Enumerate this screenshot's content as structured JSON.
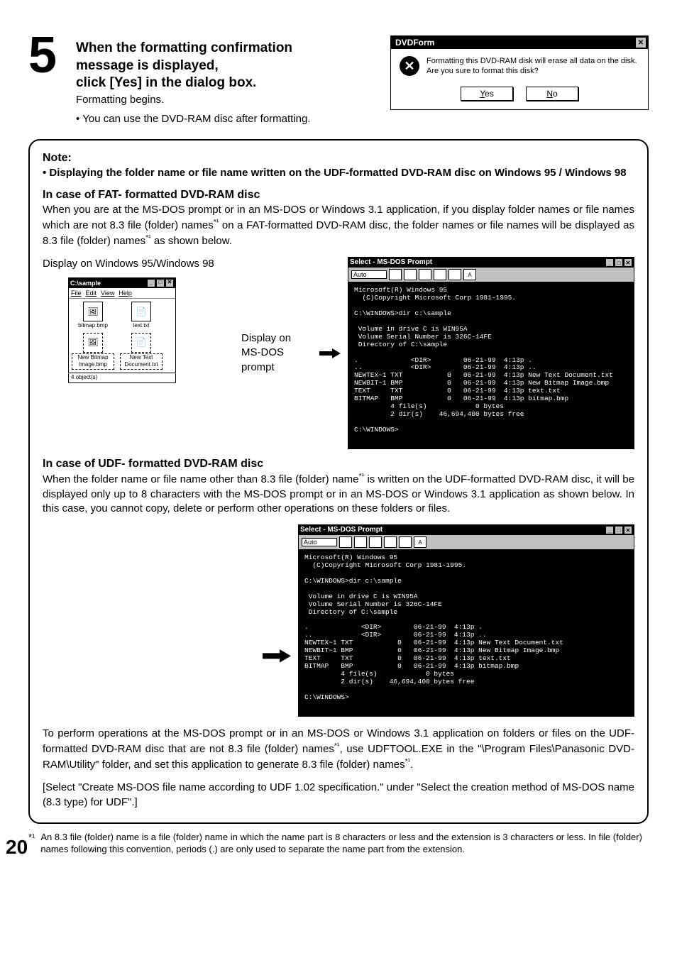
{
  "step": {
    "number": "5",
    "title_l1": "When the formatting confirmation",
    "title_l2": "message is displayed,",
    "title_l3": "click [Yes] in the dialog box.",
    "subtitle": "Formatting begins.",
    "bullet": "You can use the DVD-RAM disc after formatting."
  },
  "dialog": {
    "title": "DVDForm",
    "close": "✕",
    "msg_l1": "Formatting this DVD-RAM disk will erase all data on the disk.",
    "msg_l2": "Are you sure to format this disk?",
    "yes_u": "Y",
    "yes_rest": "es",
    "no_u": "N",
    "no_rest": "o"
  },
  "note": {
    "heading": "Note:",
    "lead": "Displaying the folder name or file name written on the UDF-formatted DVD-RAM disc on Windows 95 / Windows 98",
    "fat_title": "In case of  FAT- formatted DVD-RAM disc",
    "fat_body_a": "When you are at the MS-DOS prompt or in an MS-DOS or Windows 3.1 application, if you display folder names or file names which are not 8.3 file (folder) names",
    "fat_body_b": " on a FAT-formatted DVD-RAM disc, the folder names or file names will be displayed as 8.3 file (folder) names",
    "fat_body_c": " as shown below.",
    "win_label": "Display on Windows 95/Windows 98",
    "dos_label": "Display on MS-DOS prompt",
    "udf_title": "In case of UDF- formatted DVD-RAM disc",
    "udf_body_a": "When the folder name or file name other than 8.3 file (folder) name",
    "udf_body_b": " is written on the UDF-formatted DVD-RAM disc, it will be displayed only up to 8 characters with the MS-DOS prompt or in an MS-DOS or Windows 3.1 application as shown below.  In this case, you cannot copy, delete or perform other operations on these folders or files.",
    "tool_a": "To perform operations at the MS-DOS prompt or in an MS-DOS or Windows 3.1 application on folders or files on the UDF-formatted DVD-RAM disc that are not 8.3 file (folder) names",
    "tool_b": ", use UDFTOOL.EXE in the \"\\Program Files\\Panasonic DVD-RAM\\Utility\" folder, and set this application to generate 8.3 file (folder) names",
    "tool_c": ".",
    "tool_ref": "[Select \"Create MS-DOS file name according to UDF 1.02 specification.\" under  \"Select the creation method  of  MS-DOS name (8.3 type) for UDF\".]"
  },
  "explorer": {
    "title": "C:\\sample",
    "menu": {
      "file": "File",
      "edit": "Edit",
      "view": "View",
      "help": "Help"
    },
    "items": [
      {
        "name": "bitmap.bmp"
      },
      {
        "name": "text.txt"
      },
      {
        "name": "New Bitmap Image.bmp"
      },
      {
        "name": "New Text Document.txt"
      }
    ],
    "status_left": "4 object(s)",
    "status_right": ""
  },
  "dos1": {
    "title": "Select - MS-DOS Prompt",
    "auto": "Auto",
    "body": "Microsoft(R) Windows 95\n  (C)Copyright Microsoft Corp 1981-1995.\n\nC:\\WINDOWS>dir c:\\sample\n\n Volume in drive C is WIN95A\n Volume Serial Number is 326C-14FE\n Directory of C:\\sample\n\n.             <DIR>        06-21-99  4:13p .\n..            <DIR>        06-21-99  4:13p ..\nNEWTEX~1 TXT           0   06-21-99  4:13p New Text Document.txt\nNEWBIT~1 BMP           0   06-21-99  4:13p New Bitmap Image.bmp\nTEXT     TXT           0   06-21-99  4:13p text.txt\nBITMAP   BMP           0   06-21-99  4:13p bitmap.bmp\n         4 file(s)            0 bytes\n         2 dir(s)    46,694,400 bytes free\n\nC:\\WINDOWS>"
  },
  "dos2": {
    "title": "Select - MS-DOS Prompt",
    "auto": "Auto",
    "body": "Microsoft(R) Windows 95\n  (C)Copyright Microsoft Corp 1981-1995.\n\nC:\\WINDOWS>dir c:\\sample\n\n Volume in drive C is WIN95A\n Volume Serial Number is 326C-14FE\n Directory of C:\\sample\n\n.             <DIR>        06-21-99  4:13p .\n..            <DIR>        06-21-99  4:13p ..\nNEWTEX~1 TXT           0   06-21-99  4:13p New Text Document.txt\nNEWBIT~1 BMP           0   06-21-99  4:13p New Bitmap Image.bmp\nTEXT     TXT           0   06-21-99  4:13p text.txt\nBITMAP   BMP           0   06-21-99  4:13p bitmap.bmp\n         4 file(s)            0 bytes\n         2 dir(s)    46,694,400 bytes free\n\nC:\\WINDOWS>"
  },
  "footnote": {
    "marker": "*¹",
    "text": "An 8.3 file (folder) name is a file (folder) name in which the name part is 8 characters or less and the extension is 3 characters or less. In file (folder) names following this convention, periods (.) are only used to separate the name part from the extension."
  },
  "star": "*¹",
  "page_number": "20"
}
